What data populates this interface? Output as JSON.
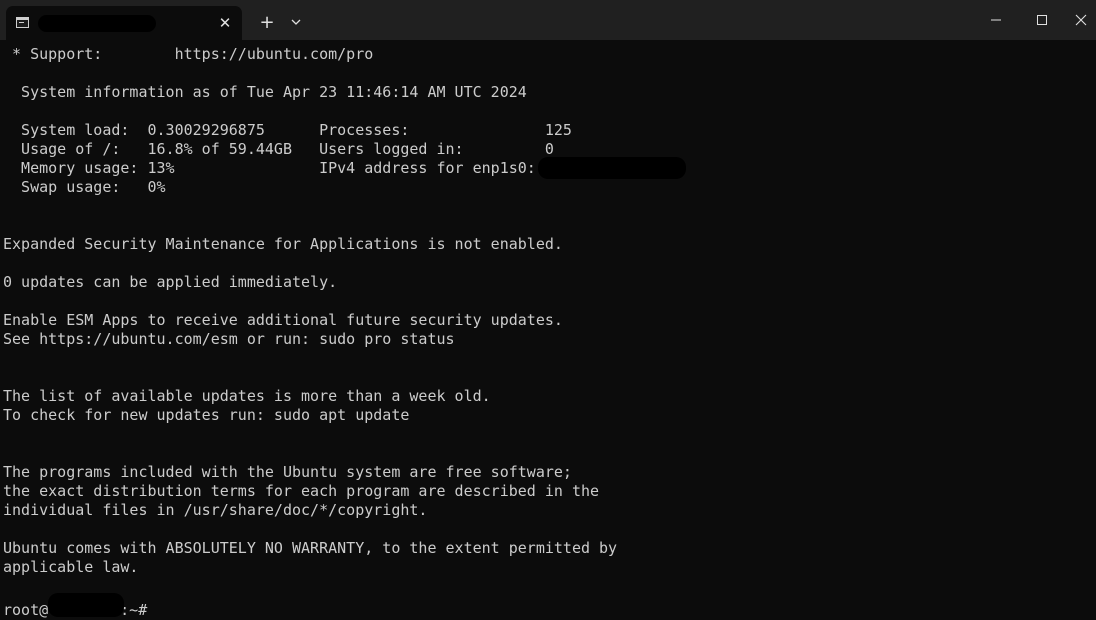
{
  "tab": {
    "icon": "terminal-icon",
    "close_glyph": "✕"
  },
  "toolbar": {
    "new_tab_glyph": "+",
    "dropdown_icon": "chevron-down-icon"
  },
  "window": {
    "minimize_icon": "minimize-icon",
    "maximize_icon": "maximize-icon",
    "close_icon": "close-icon"
  },
  "terminal": {
    "lines": {
      "l01": " * Support:        https://ubuntu.com/pro",
      "l02": "  System information as of Tue Apr 23 11:46:14 AM UTC 2024",
      "l03": "  System load:  0.30029296875      Processes:               125",
      "l04": "  Usage of /:   16.8% of 59.44GB   Users logged in:         0",
      "l05": "  Memory usage: 13%                IPv4 address for enp1s0:",
      "l06": "  Swap usage:   0%",
      "l07": "Expanded Security Maintenance for Applications is not enabled.",
      "l08": "0 updates can be applied immediately.",
      "l09": "Enable ESM Apps to receive additional future security updates.",
      "l10": "See https://ubuntu.com/esm or run: sudo pro status",
      "l11": "The list of available updates is more than a week old.",
      "l12": "To check for new updates run: sudo apt update",
      "l13": "The programs included with the Ubuntu system are free software;",
      "l14": "the exact distribution terms for each program are described in the",
      "l15": "individual files in /usr/share/doc/*/copyright.",
      "l16": "Ubuntu comes with ABSOLUTELY NO WARRANTY, to the extent permitted by",
      "l17": "applicable law."
    },
    "prompt": {
      "user": "root@",
      "suffix": ":~#"
    }
  },
  "colors": {
    "background": "#0c0c0c",
    "titlebar": "#202020",
    "text": "#cccccc"
  }
}
